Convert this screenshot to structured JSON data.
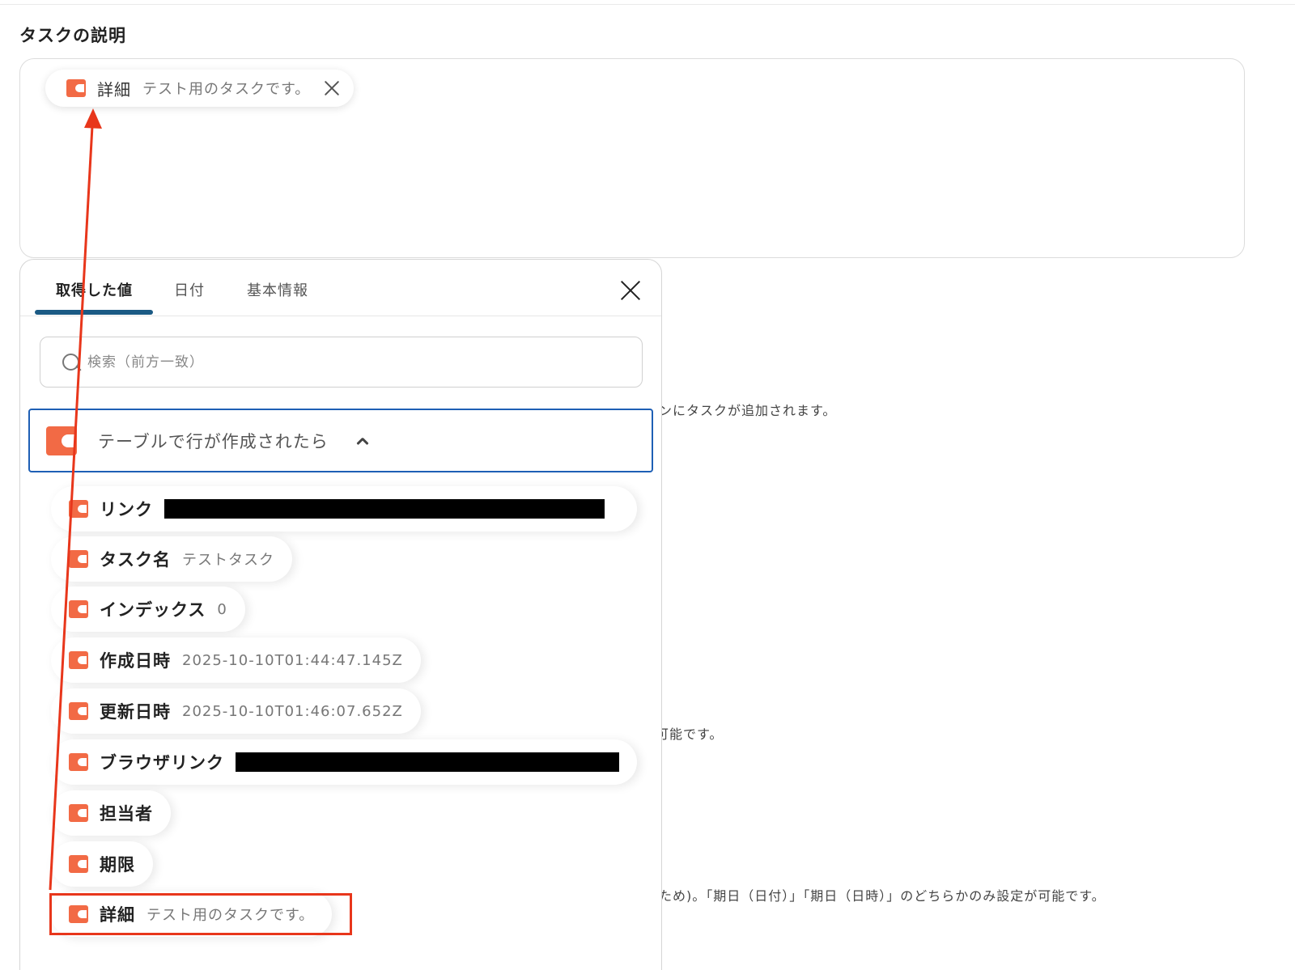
{
  "section": {
    "title": "タスクの説明"
  },
  "description_box": {
    "chip": {
      "key": "詳細",
      "value": "テスト用のタスクです。",
      "icon": "app-icon"
    }
  },
  "background_text": {
    "line1": "ンにタスクが追加されます。",
    "line2": "可能です。",
    "line3": "ため)。「期日（日付）」「期日（日時）」のどちらかのみ設定が可能です。"
  },
  "panel": {
    "tabs": [
      {
        "label": "取得した値",
        "active": true
      },
      {
        "label": "日付",
        "active": false
      },
      {
        "label": "基本情報",
        "active": false
      }
    ],
    "search": {
      "placeholder": "検索（前方一致）",
      "value": ""
    },
    "group": {
      "label": "テーブルで行が作成されたら",
      "expanded": true,
      "icon": "app-icon"
    },
    "items": [
      {
        "key": "リンク",
        "value": "",
        "redacted": true
      },
      {
        "key": "タスク名",
        "value": "テストタスク"
      },
      {
        "key": "インデックス",
        "value": "0"
      },
      {
        "key": "作成日時",
        "value": "2025-10-10T01:44:47.145Z"
      },
      {
        "key": "更新日時",
        "value": "2025-10-10T01:46:07.652Z"
      },
      {
        "key": "ブラウザリンク",
        "value": "",
        "redacted": true
      },
      {
        "key": "担当者",
        "value": ""
      },
      {
        "key": "期限",
        "value": ""
      },
      {
        "key": "詳細",
        "value": "テスト用のタスクです。",
        "highlighted": true
      }
    ]
  },
  "colors": {
    "accent_orange": "#f26a45",
    "tab_underline": "#1b5a84",
    "group_border": "#1e5fb5",
    "annotation_red": "#e8361b"
  }
}
